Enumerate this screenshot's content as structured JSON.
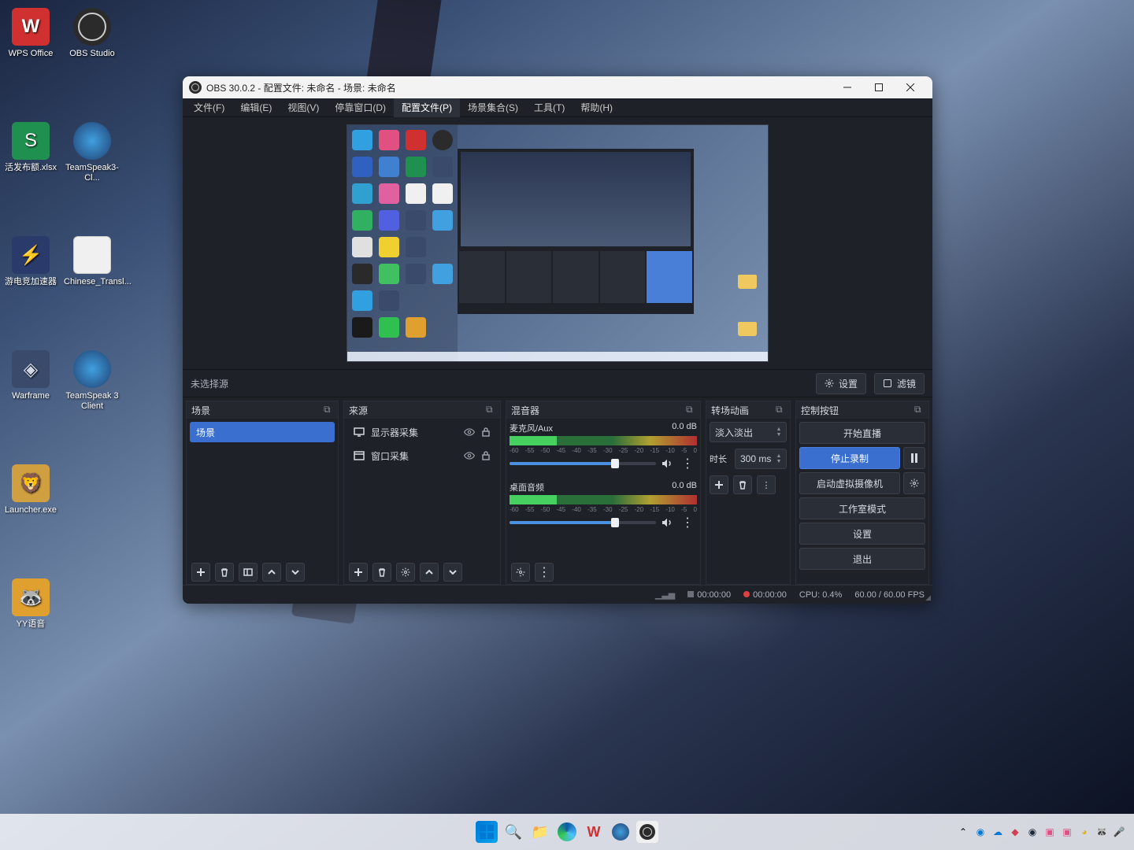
{
  "desktop": {
    "icons": [
      {
        "label": "WPS Office",
        "color": "#d03030"
      },
      {
        "label": "OBS Studio",
        "color": "#2b2b2b"
      },
      {
        "label": "活发布额.xlsx",
        "color": "#209050"
      },
      {
        "label": "TeamSpeak3-Cl...",
        "color": "#2a3a6a"
      },
      {
        "label": "游电竞加速器",
        "color": "#2a3a6a"
      },
      {
        "label": "Chinese_Transl...",
        "color": "#f0f0f0"
      },
      {
        "label": "Warframe",
        "color": "#3a4a6a"
      },
      {
        "label": "TeamSpeak 3 Client",
        "color": "#2a3a6a"
      },
      {
        "label": "Launcher.exe",
        "color": "#d0a040"
      },
      {
        "label": " ",
        "color": "transparent"
      },
      {
        "label": "YY语音",
        "color": "#e0a030"
      }
    ]
  },
  "obs": {
    "title": "OBS 30.0.2 - 配置文件: 未命名 - 场景: 未命名",
    "menu": [
      {
        "label": "文件(F)"
      },
      {
        "label": "编辑(E)"
      },
      {
        "label": "视图(V)"
      },
      {
        "label": "停靠窗口(D)"
      },
      {
        "label": "配置文件(P)",
        "selected": true
      },
      {
        "label": "场景集合(S)"
      },
      {
        "label": "工具(T)"
      },
      {
        "label": "帮助(H)"
      }
    ],
    "no_source": "未选择源",
    "settings_btn": "设置",
    "filters_btn": "滤镜",
    "docks": {
      "scenes": {
        "title": "场景",
        "items": [
          "场景"
        ]
      },
      "sources": {
        "title": "来源",
        "items": [
          "显示器采集",
          "窗口采集"
        ]
      },
      "mixer": {
        "title": "混音器",
        "channels": [
          {
            "name": "麦克风/Aux",
            "db": "0.0 dB"
          },
          {
            "name": "桌面音频",
            "db": "0.0 dB"
          }
        ],
        "ticks": [
          "-60",
          "-55",
          "-50",
          "-45",
          "-40",
          "-35",
          "-30",
          "-25",
          "-20",
          "-15",
          "-10",
          "-5",
          "0"
        ]
      },
      "trans": {
        "title": "转场动画",
        "type": "淡入淡出",
        "dur_label": "时长",
        "dur_value": "300 ms"
      },
      "controls": {
        "title": "控制按钮",
        "buttons": {
          "start_stream": "开始直播",
          "stop_record": "停止录制",
          "virt_cam": "启动虚拟摄像机",
          "studio": "工作室模式",
          "settings": "设置",
          "exit": "退出"
        }
      }
    },
    "status": {
      "live_time": "00:00:00",
      "rec_time": "00:00:00",
      "cpu": "CPU: 0.4%",
      "fps": "60.00 / 60.00 FPS"
    }
  }
}
